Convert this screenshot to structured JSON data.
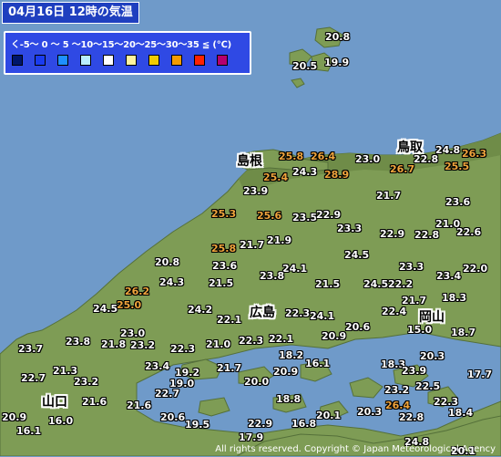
{
  "title": "04月16日 12時の気温",
  "legend": {
    "label": "く-5～ 0 ～ 5 ～10～15～20～25～30～35 ≦ (℃)",
    "colors": [
      "#00166b",
      "#1a3cf0",
      "#1e8fff",
      "#b9eeff",
      "#ffffff",
      "#fff39e",
      "#f2cc00",
      "#f59b00",
      "#ff2200",
      "#b4006f"
    ]
  },
  "prefectures": [
    {
      "id": "shimane",
      "name": "島根"
    },
    {
      "id": "tottori",
      "name": "鳥取"
    },
    {
      "id": "hiroshima",
      "name": "広島"
    },
    {
      "id": "okayama",
      "name": "岡山"
    },
    {
      "id": "yamaguchi",
      "name": "山口"
    }
  ],
  "stations": [
    {
      "value": "20.8"
    },
    {
      "value": "20.5"
    },
    {
      "value": "19.9"
    },
    {
      "value": "25.8"
    },
    {
      "value": "26.4"
    },
    {
      "value": "23.0"
    },
    {
      "value": "24.8"
    },
    {
      "value": "26.3"
    },
    {
      "value": "25.4"
    },
    {
      "value": "24.3"
    },
    {
      "value": "28.9"
    },
    {
      "value": "26.7"
    },
    {
      "value": "22.8"
    },
    {
      "value": "25.5"
    },
    {
      "value": "23.9"
    },
    {
      "value": "21.7"
    },
    {
      "value": "23.6"
    },
    {
      "value": "25.3"
    },
    {
      "value": "25.6"
    },
    {
      "value": "23.5"
    },
    {
      "value": "22.9"
    },
    {
      "value": "21.0"
    },
    {
      "value": "23.3"
    },
    {
      "value": "22.9"
    },
    {
      "value": "22.8"
    },
    {
      "value": "22.6"
    },
    {
      "value": "25.8"
    },
    {
      "value": "21.7"
    },
    {
      "value": "21.9"
    },
    {
      "value": "24.5"
    },
    {
      "value": "20.8"
    },
    {
      "value": "23.6"
    },
    {
      "value": "24.1"
    },
    {
      "value": "23.3"
    },
    {
      "value": "22.0"
    },
    {
      "value": "26.2"
    },
    {
      "value": "24.3"
    },
    {
      "value": "23.8"
    },
    {
      "value": "23.4"
    },
    {
      "value": "21.5"
    },
    {
      "value": "21.5"
    },
    {
      "value": "24.5"
    },
    {
      "value": "22.2"
    },
    {
      "value": "25.0"
    },
    {
      "value": "24.5"
    },
    {
      "value": "24.2"
    },
    {
      "value": "21.7"
    },
    {
      "value": "18.3"
    },
    {
      "value": "22.1"
    },
    {
      "value": "22.3"
    },
    {
      "value": "24.1"
    },
    {
      "value": "22.4"
    },
    {
      "value": "23.0"
    },
    {
      "value": "20.6"
    },
    {
      "value": "15.0"
    },
    {
      "value": "23.7"
    },
    {
      "value": "23.8"
    },
    {
      "value": "21.8"
    },
    {
      "value": "23.2"
    },
    {
      "value": "22.3"
    },
    {
      "value": "21.0"
    },
    {
      "value": "22.3"
    },
    {
      "value": "22.1"
    },
    {
      "value": "20.9"
    },
    {
      "value": "18.7"
    },
    {
      "value": "18.2"
    },
    {
      "value": "20.3"
    },
    {
      "value": "23.4"
    },
    {
      "value": "16.1"
    },
    {
      "value": "18.3"
    },
    {
      "value": "21.3"
    },
    {
      "value": "19.2"
    },
    {
      "value": "21.7"
    },
    {
      "value": "20.9"
    },
    {
      "value": "23.9"
    },
    {
      "value": "17.7"
    },
    {
      "value": "22.7"
    },
    {
      "value": "23.2"
    },
    {
      "value": "19.0"
    },
    {
      "value": "20.0"
    },
    {
      "value": "22.5"
    },
    {
      "value": "22.7"
    },
    {
      "value": "23.2"
    },
    {
      "value": "21.6"
    },
    {
      "value": "21.6"
    },
    {
      "value": "18.8"
    },
    {
      "value": "22.3"
    },
    {
      "value": "26.4"
    },
    {
      "value": "20.9"
    },
    {
      "value": "16.0"
    },
    {
      "value": "20.6"
    },
    {
      "value": "19.5"
    },
    {
      "value": "20.1"
    },
    {
      "value": "20.3"
    },
    {
      "value": "22.8"
    },
    {
      "value": "18.4"
    },
    {
      "value": "16.1"
    },
    {
      "value": "22.9"
    },
    {
      "value": "16.8"
    },
    {
      "value": "17.9"
    },
    {
      "value": "24.8"
    },
    {
      "value": "20.1"
    }
  ],
  "copyright": "All rights reserved. Copyright © Japan Meteorological Agency"
}
